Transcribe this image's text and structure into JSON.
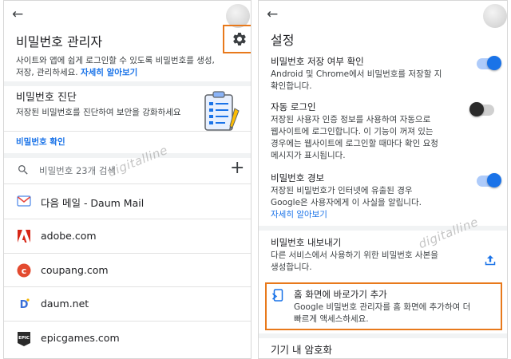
{
  "left": {
    "back_icon": "arrow-left-icon",
    "avatar_icon": "avatar",
    "title": "비밀번호 관리자",
    "settings_icon": "gear-icon",
    "desc_line1": "사이트와 앱에 쉽게 로그인할 수 있도록 비밀번호를 생성,",
    "desc_line2": "저장, 관리하세요.",
    "desc_link": "자세히 알아보기",
    "checkup": {
      "title": "비밀번호 진단",
      "desc": "저장된 비밀번호를 진단하여 보안을 강화하세요",
      "link": "비밀번호 확인",
      "illustration": "clipboard-checklist-icon"
    },
    "search": {
      "icon": "search-icon",
      "placeholder": "비밀번호 23개 검색",
      "add_icon": "plus-icon"
    },
    "sites": [
      {
        "label": "다음 메일 - Daum Mail",
        "icon": "daum-mail-icon"
      },
      {
        "label": "adobe.com",
        "icon": "adobe-icon"
      },
      {
        "label": "coupang.com",
        "icon": "coupang-icon"
      },
      {
        "label": "daum.net",
        "icon": "daum-icon"
      },
      {
        "label": "epicgames.com",
        "icon": "epicgames-icon"
      }
    ],
    "watermark": "digitalline"
  },
  "right": {
    "back_icon": "arrow-left-icon",
    "title": "설정",
    "items": [
      {
        "title": "비밀번호 저장 여부 확인",
        "desc1": "Android 및 Chrome에서 비밀번호를 저장할 지",
        "desc2": "확인합니다.",
        "toggle": "on"
      },
      {
        "title": "자동 로그인",
        "desc1": "저장된 사용자 인증 정보를 사용하여 자동으로",
        "desc2": "웹사이트에 로그인합니다. 이 기능이 꺼져 있는",
        "desc3": "경우에는 웹사이트에 로그인할 때마다 확인 요청",
        "desc4": "메시지가 표시됩니다.",
        "toggle": "off"
      },
      {
        "title": "비밀번호 경보",
        "desc1": "저장된 비밀번호가 인터넷에 유출된 경우",
        "desc2": "Google은 사용자에게 이 사실을 알립니다.",
        "link": "자세히 알아보기",
        "toggle": "on"
      }
    ],
    "export": {
      "title": "비밀번호 내보내기",
      "desc1": "다른 서비스에서 사용하기 위한 비밀번호 사본을",
      "desc2": "생성합니다.",
      "icon": "upload-icon"
    },
    "shortcut": {
      "title": "홈 화면에 바로가기 추가",
      "desc1": "Google 비밀번호 관리자를 홈 화면에 추가하여 더",
      "desc2": "빠르게 액세스하세요.",
      "icon": "add-to-home-icon"
    },
    "encryption_title": "기기 내 암호화",
    "watermark": "digitalline"
  },
  "colors": {
    "accent": "#1a73e8",
    "highlight": "#e8791b",
    "toggle_track_on": "#aecbfa"
  }
}
